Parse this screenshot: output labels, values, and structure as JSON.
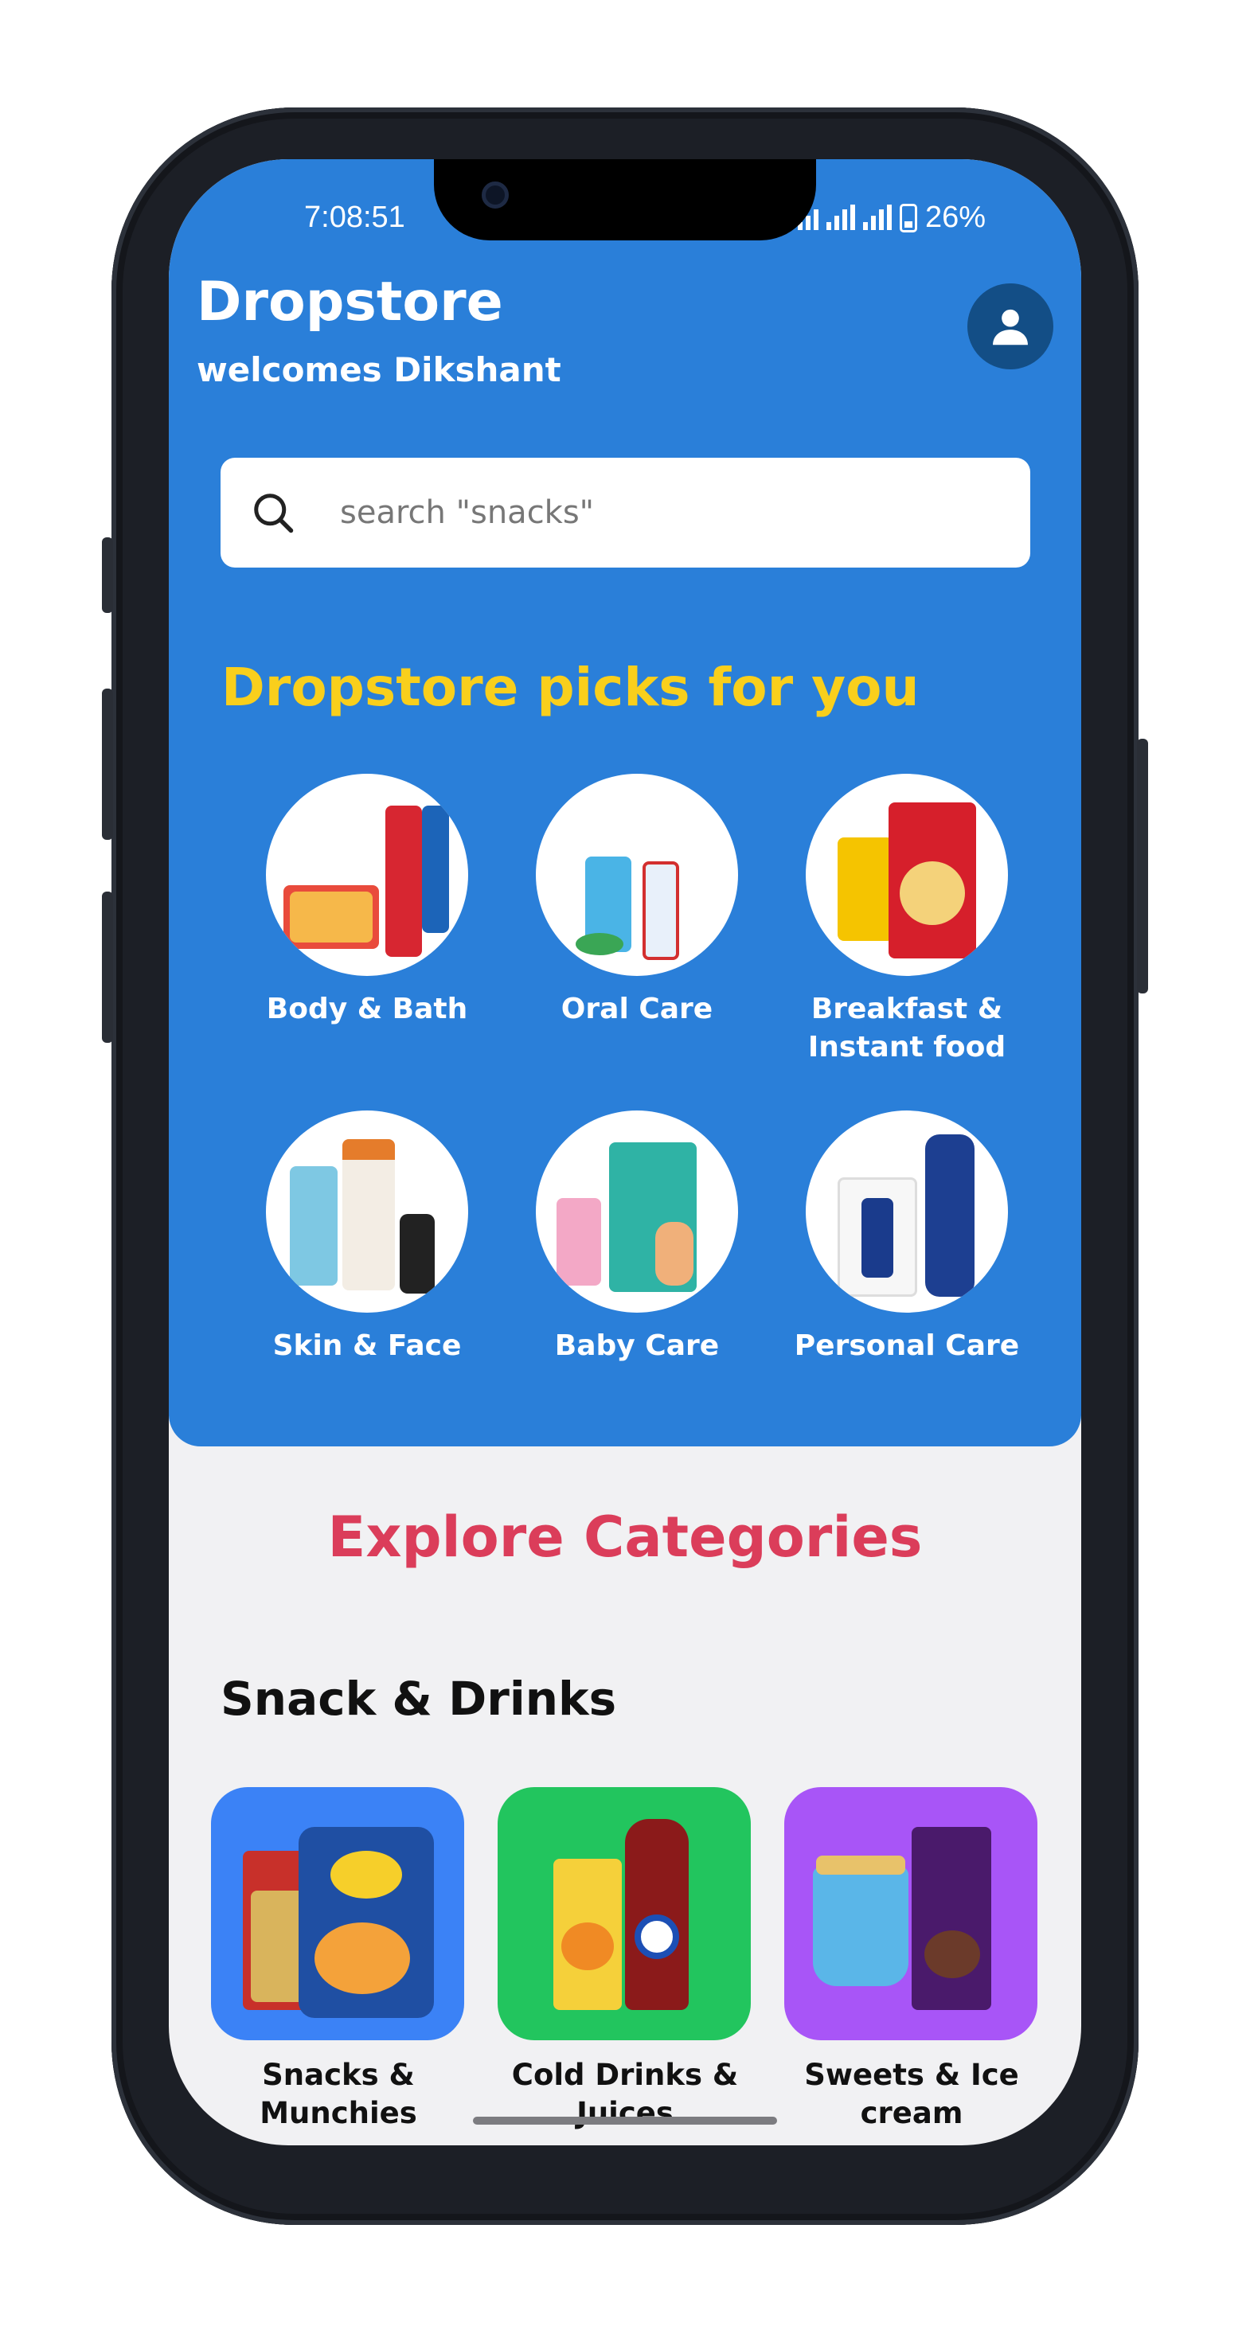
{
  "status": {
    "time": "7:08:51",
    "battery": "26%"
  },
  "header": {
    "title": "Dropstore",
    "subtitle": "welcomes Dikshant"
  },
  "search": {
    "placeholder": "search \"snacks\""
  },
  "picks": {
    "title": "Dropstore picks for you",
    "items": [
      {
        "label": "Body & Bath"
      },
      {
        "label": "Oral Care"
      },
      {
        "label": "Breakfast & Instant food"
      },
      {
        "label": "Skin & Face"
      },
      {
        "label": "Baby Care"
      },
      {
        "label": "Personal Care"
      }
    ]
  },
  "explore": {
    "title": "Explore Categories",
    "section": "Snack & Drinks",
    "categories": [
      {
        "label": "Snacks & Munchies",
        "color": "#3b82f6"
      },
      {
        "label": "Cold Drinks & Juices",
        "color": "#22c55e"
      },
      {
        "label": "Sweets & Ice cream",
        "color": "#a855f7"
      }
    ]
  },
  "colors": {
    "header": "#2a7fd9",
    "accent_yellow": "#f9cf1c",
    "accent_red": "#db3d5a"
  }
}
